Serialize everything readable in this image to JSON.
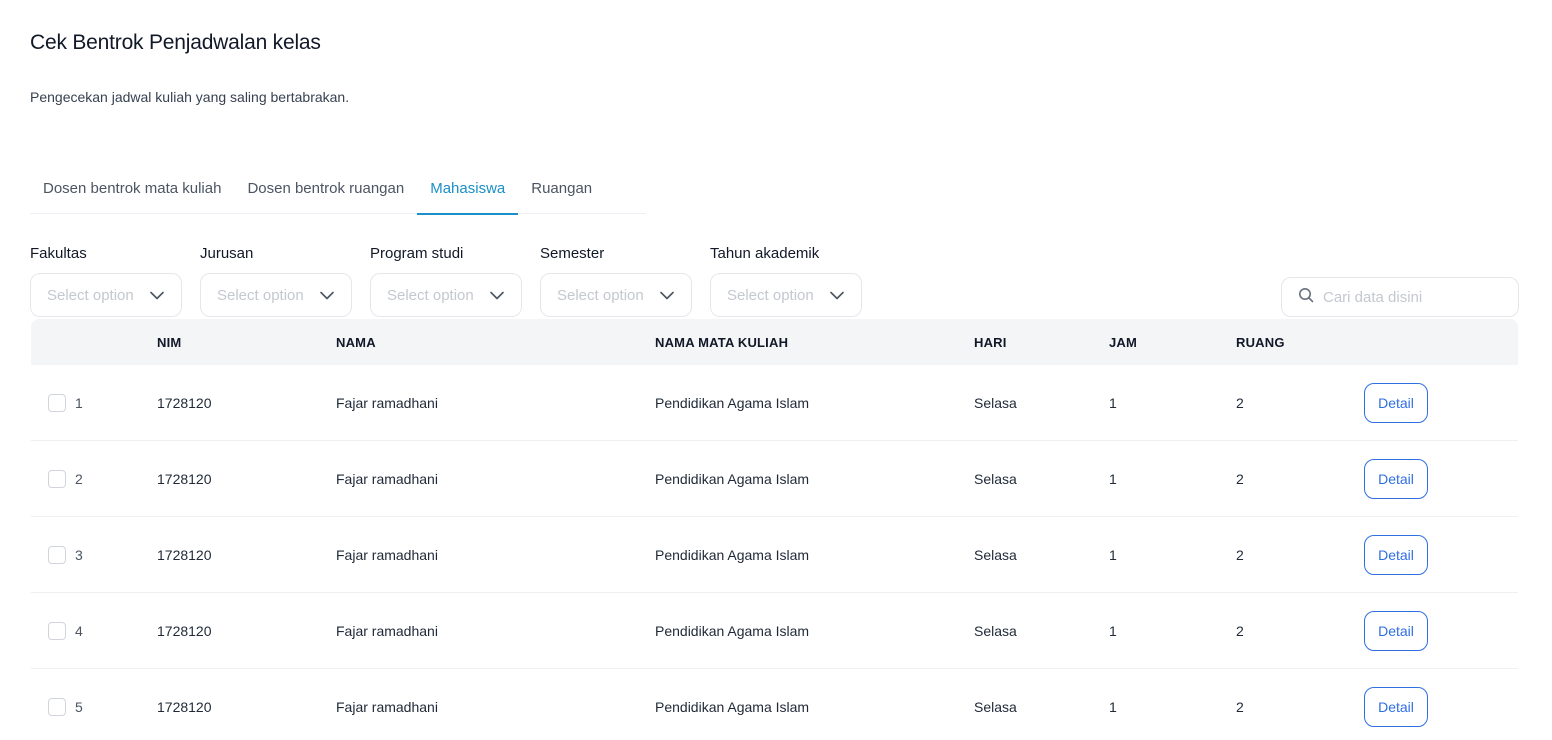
{
  "header": {
    "title": "Cek Bentrok Penjadwalan kelas",
    "subtitle": "Pengecekan jadwal kuliah yang saling bertabrakan."
  },
  "tabs": [
    {
      "label": "Dosen bentrok mata kuliah",
      "active": false
    },
    {
      "label": "Dosen bentrok ruangan",
      "active": false
    },
    {
      "label": "Mahasiswa",
      "active": true
    },
    {
      "label": "Ruangan",
      "active": false
    }
  ],
  "filters": [
    {
      "label": "Fakultas",
      "placeholder": "Select option"
    },
    {
      "label": "Jurusan",
      "placeholder": "Select option"
    },
    {
      "label": "Program studi",
      "placeholder": "Select option"
    },
    {
      "label": "Semester",
      "placeholder": "Select option"
    },
    {
      "label": "Tahun akademik",
      "placeholder": "Select option"
    }
  ],
  "search": {
    "placeholder": "Cari data disini",
    "icon": "search-icon"
  },
  "table": {
    "columns": [
      "",
      "NIM",
      "NAMA",
      "NAMA MATA KULIAH",
      "HARI",
      "JAM",
      "RUANG",
      ""
    ],
    "rows": [
      {
        "no": "1",
        "nim": "1728120",
        "nama": "Fajar ramadhani",
        "mata_kuliah": "Pendidikan Agama Islam",
        "hari": "Selasa",
        "jam": "1",
        "ruang": "2",
        "action": "Detail"
      },
      {
        "no": "2",
        "nim": "1728120",
        "nama": "Fajar ramadhani",
        "mata_kuliah": "Pendidikan Agama Islam",
        "hari": "Selasa",
        "jam": "1",
        "ruang": "2",
        "action": "Detail"
      },
      {
        "no": "3",
        "nim": "1728120",
        "nama": "Fajar ramadhani",
        "mata_kuliah": "Pendidikan Agama Islam",
        "hari": "Selasa",
        "jam": "1",
        "ruang": "2",
        "action": "Detail"
      },
      {
        "no": "4",
        "nim": "1728120",
        "nama": "Fajar ramadhani",
        "mata_kuliah": "Pendidikan Agama Islam",
        "hari": "Selasa",
        "jam": "1",
        "ruang": "2",
        "action": "Detail"
      },
      {
        "no": "5",
        "nim": "1728120",
        "nama": "Fajar ramadhani",
        "mata_kuliah": "Pendidikan Agama Islam",
        "hari": "Selasa",
        "jam": "1",
        "ruang": "2",
        "action": "Detail"
      }
    ]
  },
  "colors": {
    "accent": "#1a8fc9",
    "button": "#2f6fe0",
    "header_bg": "#f4f5f6"
  }
}
